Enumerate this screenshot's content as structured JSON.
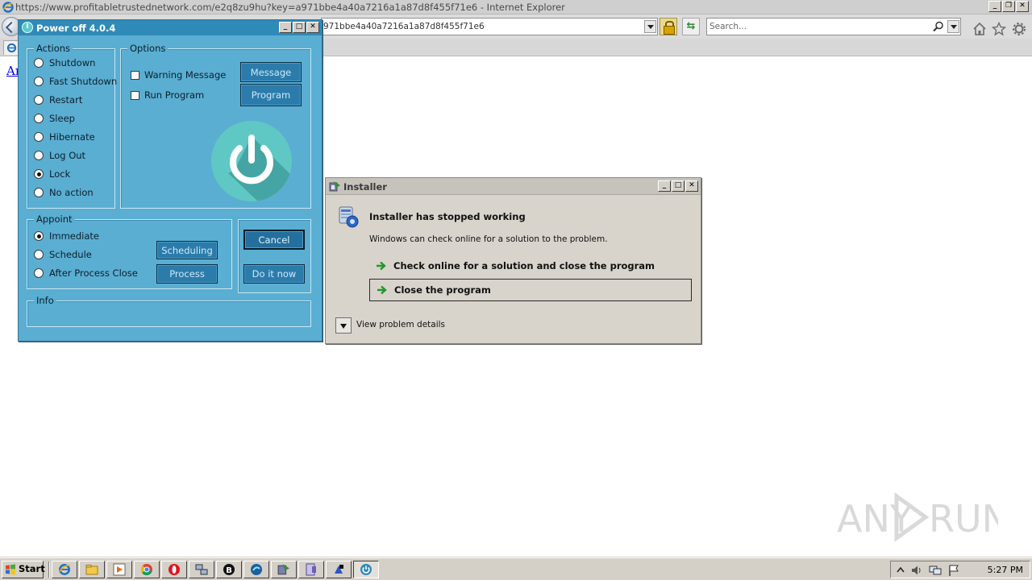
{
  "browser": {
    "title": "https://www.profitabletrustednetwork.com/e2q8zu9hu?key=a971bbe4a40a7216a1a87d8f455f71e6 - Internet Explorer",
    "address_visible": "971bbe4a40a7216a1a87d8f455f71e6",
    "search_placeholder": "Search...",
    "page_link_text": "Ar"
  },
  "poweroff": {
    "title": "Power off 4.0.4",
    "actions": {
      "title": "Actions",
      "items": [
        {
          "label": "Shutdown",
          "selected": false
        },
        {
          "label": "Fast Shutdown",
          "selected": false
        },
        {
          "label": "Restart",
          "selected": false
        },
        {
          "label": "Sleep",
          "selected": false
        },
        {
          "label": "Hibernate",
          "selected": false
        },
        {
          "label": "Log Out",
          "selected": false
        },
        {
          "label": "Lock",
          "selected": true
        },
        {
          "label": "No action",
          "selected": false
        }
      ]
    },
    "options": {
      "title": "Options",
      "warning_label": "Warning Message",
      "run_program_label": "Run Program",
      "message_button": "Message",
      "program_button": "Program"
    },
    "appoint": {
      "title": "Appoint",
      "items": [
        {
          "label": "Immediate",
          "selected": true
        },
        {
          "label": "Schedule",
          "selected": false
        },
        {
          "label": "After Process Close",
          "selected": false
        }
      ],
      "scheduling_button": "Scheduling",
      "process_button": "Process"
    },
    "cancel_button": "Cancel",
    "do_it_now_button": "Do it now",
    "info_title": "Info"
  },
  "installer": {
    "title": "Installer",
    "headline": "Installer has stopped working",
    "subtext": "Windows can check online for a solution to the problem.",
    "option_check_online": "Check online for a solution and close the program",
    "option_close": "Close the program",
    "details_label": "View problem details"
  },
  "watermark": {
    "text_left": "ANY",
    "text_right": "RUN"
  },
  "taskbar": {
    "start_label": "Start",
    "clock": "5:27 PM"
  },
  "colors": {
    "poweroff_bg": "#5aaed2",
    "poweroff_title": "#2f8ab8",
    "button_blue": "#2b7cab",
    "installer_bg": "#d8d4cc"
  }
}
